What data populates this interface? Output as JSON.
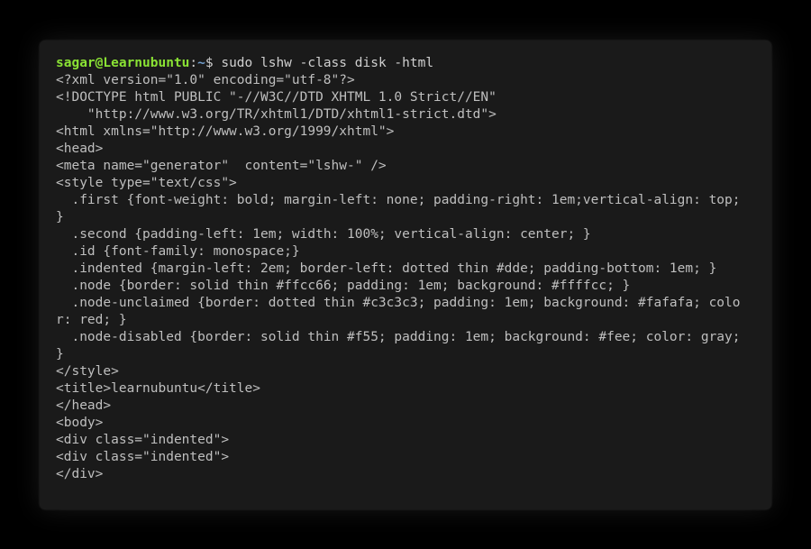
{
  "prompt": {
    "user_host": "sagar@Learnubuntu",
    "separator": ":",
    "path": "~",
    "symbol": "$ ",
    "command": "sudo lshw -class disk -html"
  },
  "output_lines": [
    "<?xml version=\"1.0\" encoding=\"utf-8\"?>",
    "<!DOCTYPE html PUBLIC \"-//W3C//DTD XHTML 1.0 Strict//EN\"",
    "    \"http://www.w3.org/TR/xhtml1/DTD/xhtml1-strict.dtd\">",
    "<html xmlns=\"http://www.w3.org/1999/xhtml\">",
    "<head>",
    "<meta name=\"generator\"  content=\"lshw-\" />",
    "<style type=\"text/css\">",
    "  .first {font-weight: bold; margin-left: none; padding-right: 1em;vertical-align: top; }",
    "  .second {padding-left: 1em; width: 100%; vertical-align: center; }",
    "  .id {font-family: monospace;}",
    "  .indented {margin-left: 2em; border-left: dotted thin #dde; padding-bottom: 1em; }",
    "  .node {border: solid thin #ffcc66; padding: 1em; background: #ffffcc; }",
    "  .node-unclaimed {border: dotted thin #c3c3c3; padding: 1em; background: #fafafa; color: red; }",
    "  .node-disabled {border: solid thin #f55; padding: 1em; background: #fee; color: gray; }",
    "</style>",
    "<title>learnubuntu</title>",
    "</head>",
    "<body>",
    "<div class=\"indented\">",
    "<div class=\"indented\">",
    "</div>"
  ]
}
